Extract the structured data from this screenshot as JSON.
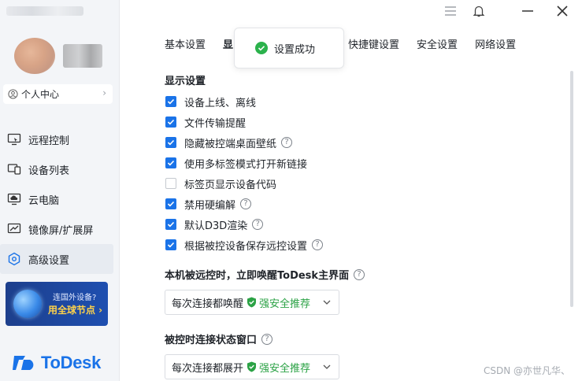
{
  "sidebar": {
    "personal_center": "个人中心",
    "nav_items": [
      {
        "label": "远程控制",
        "icon": "remote-control-icon"
      },
      {
        "label": "设备列表",
        "icon": "device-list-icon"
      },
      {
        "label": "云电脑",
        "icon": "cloud-pc-icon"
      },
      {
        "label": "镜像屏/扩展屏",
        "icon": "mirror-screen-icon"
      },
      {
        "label": "高级设置",
        "icon": "advanced-settings-icon",
        "active": true
      }
    ],
    "promo": {
      "line1": "连国外设备?",
      "line2": "用全球节点 ›"
    },
    "logo_text": "ToDesk"
  },
  "window_controls": [
    "menu-icon",
    "bell-icon",
    "minimize-icon",
    "close-icon"
  ],
  "tabs": [
    {
      "label": "基本设置"
    },
    {
      "label": "显"
    },
    {
      "label": "快捷键设置"
    },
    {
      "label": "安全设置"
    },
    {
      "label": "网络设置"
    }
  ],
  "toast": {
    "text": "设置成功"
  },
  "display_settings": {
    "title": "显示设置",
    "options": [
      {
        "label": "设备上线、离线",
        "checked": true,
        "help": false
      },
      {
        "label": "文件传输提醒",
        "checked": true,
        "help": false
      },
      {
        "label": "隐藏被控端桌面壁纸",
        "checked": true,
        "help": true
      },
      {
        "label": "使用多标签模式打开新链接",
        "checked": true,
        "help": false
      },
      {
        "label": "标签页显示设备代码",
        "checked": false,
        "help": false
      },
      {
        "label": "禁用硬编解",
        "checked": true,
        "help": true
      },
      {
        "label": "默认D3D渲染",
        "checked": true,
        "help": true
      },
      {
        "label": "根据被控设备保存远控设置",
        "checked": true,
        "help": true
      }
    ]
  },
  "wake_setting": {
    "title": "本机被远控时，立即唤醒ToDesk主界面",
    "value": "每次连接都唤醒",
    "recommend": "强安全推荐"
  },
  "status_window": {
    "title": "被控时连接状态窗口",
    "value": "每次连接都展开",
    "recommend": "强安全推荐"
  },
  "watermark": "CSDN @亦世凡华、",
  "colors": {
    "accent": "#1a73e8",
    "success": "#2bb24c",
    "sidebar_bg": "#f3f5f8"
  }
}
